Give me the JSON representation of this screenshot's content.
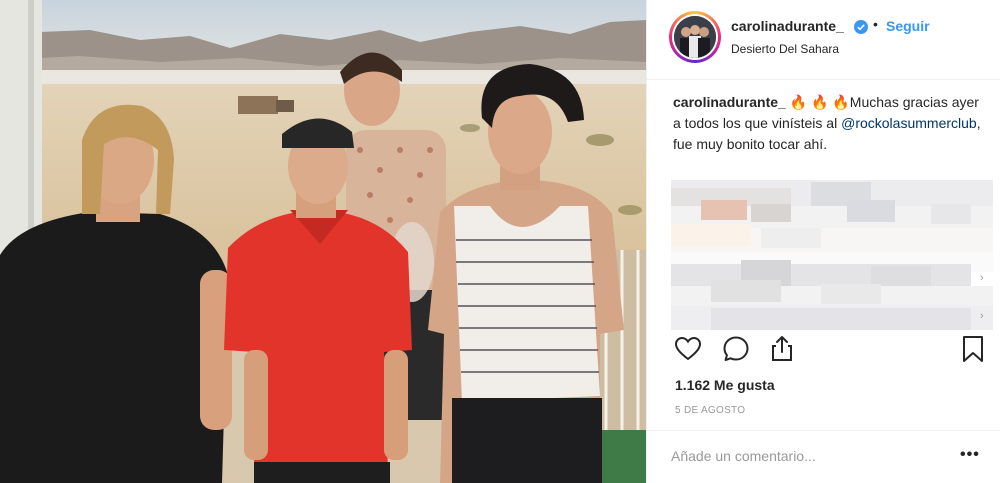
{
  "post": {
    "username": "carolinadurante_",
    "separator": "•",
    "follow_label": "Seguir",
    "location": "Desierto Del Sahara",
    "caption": {
      "user": "carolinadurante_",
      "emoji": "🔥 🔥 🔥",
      "text_1": "Muchas gracias ayer a todos los que vinísteis al ",
      "mention": "@rockolasummerclub",
      "text_2": ", fue muy bonito tocar ahí."
    },
    "likes": "1.162 Me gusta",
    "date": "5 DE AGOSTO",
    "comment_placeholder": "Añade un comentario...",
    "more_label": "•••"
  },
  "icons": {
    "verified": "verified-badge-icon",
    "like": "heart-icon",
    "comment": "comment-bubble-icon",
    "share": "share-icon",
    "save": "bookmark-icon",
    "more": "more-options-icon"
  },
  "colors": {
    "accent": "#3897f0",
    "mention": "#003569",
    "muted": "#999999",
    "text": "#262626",
    "border": "#efefef"
  }
}
